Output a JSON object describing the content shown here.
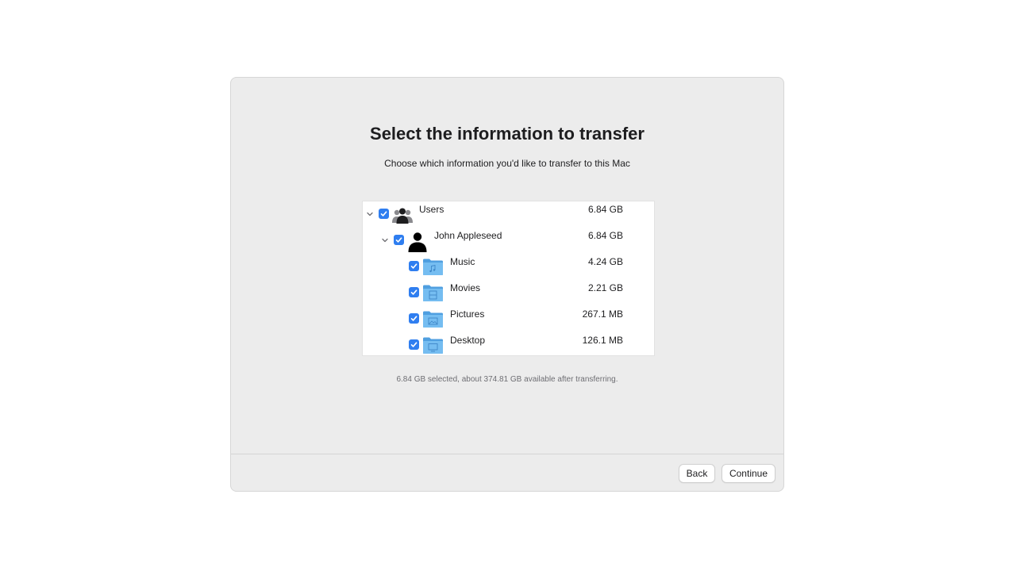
{
  "page": {
    "title": "Select the information to transfer",
    "subtitle": "Choose which information you'd like to transfer to this Mac"
  },
  "tree": {
    "items": [
      {
        "label": "Users",
        "size": "6.84 GB",
        "checked": true,
        "expanded": true,
        "icon": "users-group-icon"
      },
      {
        "label": "John Appleseed",
        "size": "6.84 GB",
        "checked": true,
        "expanded": true,
        "icon": "user-icon"
      },
      {
        "label": "Music",
        "size": "4.24 GB",
        "checked": true,
        "icon": "music-folder-icon"
      },
      {
        "label": "Movies",
        "size": "2.21 GB",
        "checked": true,
        "icon": "movies-folder-icon"
      },
      {
        "label": "Pictures",
        "size": "267.1 MB",
        "checked": true,
        "icon": "pictures-folder-icon"
      },
      {
        "label": "Desktop",
        "size": "126.1 MB",
        "checked": true,
        "icon": "desktop-folder-icon"
      }
    ]
  },
  "status": {
    "text": "6.84 GB selected, about 374.81 GB available after transferring."
  },
  "footer": {
    "back_label": "Back",
    "continue_label": "Continue"
  },
  "colors": {
    "accent": "#2f7ef0",
    "folder": "#5aaee8",
    "window_bg": "#ececec"
  }
}
